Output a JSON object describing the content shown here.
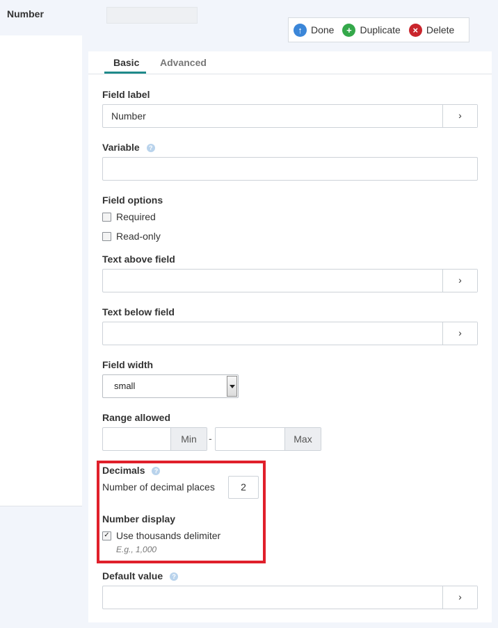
{
  "header": {
    "field_name": "Number"
  },
  "actions": {
    "done": "Done",
    "duplicate": "Duplicate",
    "delete": "Delete"
  },
  "tabs": {
    "basic": "Basic",
    "advanced": "Advanced"
  },
  "form": {
    "field_label": {
      "label": "Field label",
      "value": "Number",
      "expand": "›"
    },
    "variable": {
      "label": "Variable",
      "value": ""
    },
    "field_options": {
      "label": "Field options",
      "required": {
        "label": "Required",
        "checked": false
      },
      "read_only": {
        "label": "Read-only",
        "checked": false
      }
    },
    "text_above": {
      "label": "Text above field",
      "value": "",
      "expand": "›"
    },
    "text_below": {
      "label": "Text below field",
      "value": "",
      "expand": "›"
    },
    "field_width": {
      "label": "Field width",
      "selected": "small"
    },
    "range": {
      "label": "Range allowed",
      "min_addon": "Min",
      "max_addon": "Max",
      "separator": "-"
    },
    "decimals": {
      "label": "Decimals",
      "places_label": "Number of decimal places",
      "places_value": "2"
    },
    "number_display": {
      "label": "Number display",
      "thousands": {
        "label": "Use thousands delimiter",
        "checked": true,
        "hint": "E.g., 1,000"
      }
    },
    "default_value": {
      "label": "Default value",
      "value": "",
      "expand": "›"
    }
  },
  "colors": {
    "accent_tab": "#1f8a8a",
    "highlight_border": "#e0202b",
    "done_icon": "#3b86d8",
    "duplicate_icon": "#34a84a",
    "delete_icon": "#c9252c"
  }
}
